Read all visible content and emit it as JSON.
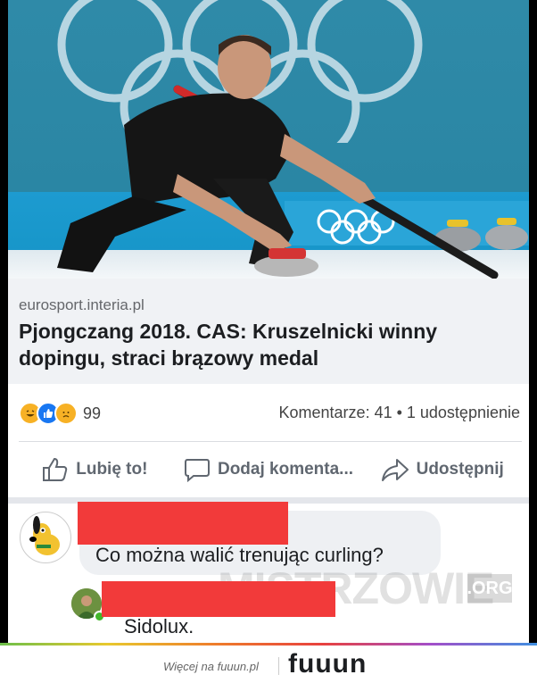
{
  "post": {
    "domain": "eurosport.interia.pl",
    "headline": "Pjongczang 2018. CAS: Kruszelnicki winny dopingu, straci brązowy medal"
  },
  "reactions": {
    "icons": [
      "haha-icon",
      "like-icon",
      "sad-icon"
    ],
    "count": "99",
    "stats": "Komentarze: 41 • 1 udostępnienie"
  },
  "actions": {
    "like": "Lubię to!",
    "comment": "Dodaj komenta...",
    "share": "Udostępnij"
  },
  "comments": [
    {
      "text": "Co można walić trenując curling?"
    },
    {
      "text": "Sidolux."
    }
  ],
  "watermark": {
    "main": "MISTRZOWIE",
    "suffix": ".ORG"
  },
  "footer": {
    "text": "Więcej na fuuun.pl",
    "logo": "fuuun"
  },
  "colors": {
    "redaction": "#f23a3a",
    "fb_blue": "#1877f2",
    "preview_bg": "#f0f2f5"
  }
}
